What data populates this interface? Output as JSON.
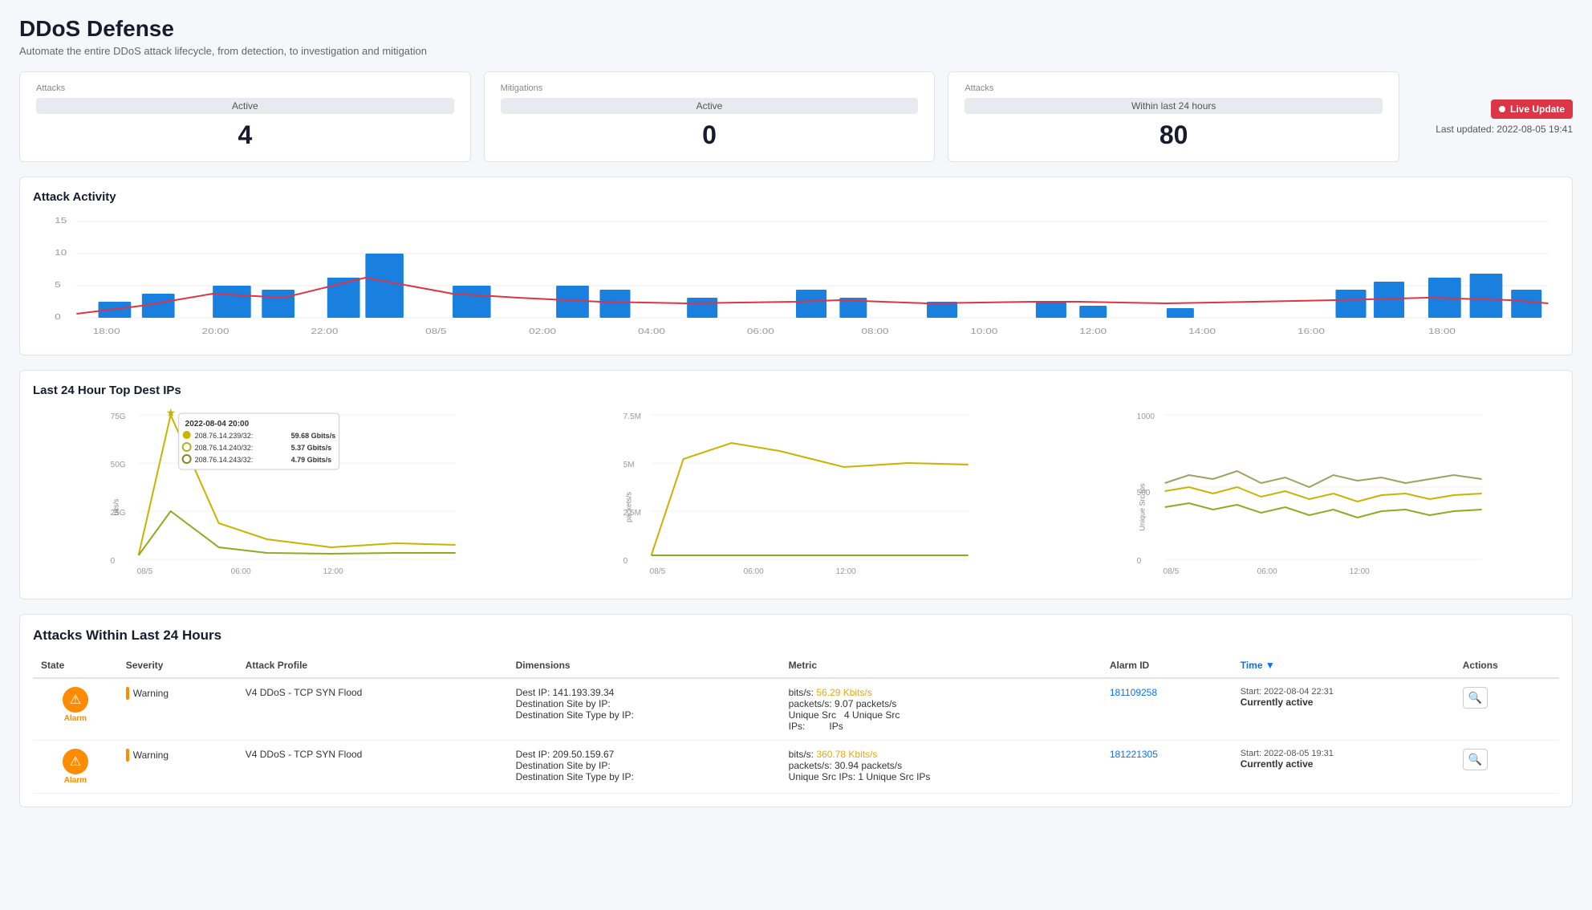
{
  "page": {
    "title": "DDoS Defense",
    "subtitle": "Automate the entire DDoS attack lifecycle, from detection, to investigation and mitigation"
  },
  "summary": {
    "attacks_active_label": "Attacks",
    "attacks_active_sublabel": "Active",
    "attacks_active_value": "4",
    "mitigations_active_label": "Mitigations",
    "mitigations_active_sublabel": "Active",
    "mitigations_active_value": "0",
    "attacks_24h_label": "Attacks",
    "attacks_24h_sublabel": "Within last 24 hours",
    "attacks_24h_value": "80",
    "live_badge": "Live Update",
    "last_updated": "Last updated: 2022-08-05 19:41"
  },
  "attack_activity": {
    "title": "Attack Activity",
    "y_labels": [
      "15",
      "10",
      "5",
      "0"
    ],
    "x_labels": [
      "18:00",
      "20:00",
      "22:00",
      "08/5",
      "02:00",
      "04:00",
      "06:00",
      "08:00",
      "10:00",
      "12:00",
      "14:00",
      "16:00",
      "18:00"
    ]
  },
  "top_dest_ips": {
    "title": "Last 24 Hour Top Dest IPs",
    "tooltip": {
      "time": "2022-08-04 20:00",
      "items": [
        {
          "color": "#c8b400",
          "label": "208.76.14.239/32:",
          "value": "59.68 Gbits/s"
        },
        {
          "color": "#b0b020",
          "label": "208.76.14.240/32:",
          "value": "5.37 Gbits/s"
        },
        {
          "color": "#808820",
          "label": "208.76.14.243/32:",
          "value": "4.79 Gbits/s"
        }
      ]
    },
    "chart1": {
      "y_label": "bits/s",
      "y_ticks": [
        "75G",
        "50G",
        "25G",
        "0"
      ],
      "x_ticks": [
        "08/5",
        "06:00",
        "12:00"
      ]
    },
    "chart2": {
      "y_label": "packets/s",
      "y_ticks": [
        "7.5M",
        "5M",
        "2.5M",
        "0"
      ],
      "x_ticks": [
        "08/5",
        "06:00",
        "12:00"
      ]
    },
    "chart3": {
      "y_label": "Unique Src Ips",
      "y_ticks": [
        "1000",
        "500",
        "0"
      ],
      "x_ticks": [
        "08/5",
        "06:00",
        "12:00"
      ]
    }
  },
  "attacks_table": {
    "title": "Attacks Within Last 24 Hours",
    "columns": [
      "State",
      "Severity",
      "Attack Profile",
      "Dimensions",
      "Metric",
      "Alarm ID",
      "Time",
      "Actions"
    ],
    "sortable_col": "Time",
    "rows": [
      {
        "state": "Alarm",
        "severity": "Warning",
        "attack_profile": "V4 DDoS - TCP SYN Flood",
        "dimensions": "Dest IP: 141.193.39.34\nDestination Site by IP:\nDestination Site Type by IP:",
        "metric_label1": "bits/s:",
        "metric_val1": "56.29 Kbits/s",
        "metric_label2": "packets/s:",
        "metric_val2": "9.07 packets/s",
        "metric_label3": "Unique Src",
        "metric_val3": "4 Unique Src",
        "metric_label4": "IPs:",
        "metric_val4": "IPs",
        "alarm_id": "181109258",
        "start_time": "Start:   2022-08-04 22:31",
        "status": "Currently active"
      },
      {
        "state": "Alarm",
        "severity": "Warning",
        "attack_profile": "V4 DDoS - TCP SYN Flood",
        "dimensions": "Dest IP: 209.50.159.67\nDestination Site by IP:\nDestination Site Type by IP:",
        "metric_label1": "bits/s:",
        "metric_val1": "360.78 Kbits/s",
        "metric_label2": "packets/s:",
        "metric_val2": "30.94 packets/s",
        "metric_label3": "Unique Src IPs:",
        "metric_val3": "1 Unique Src IPs",
        "metric_label4": "",
        "metric_val4": "",
        "alarm_id": "181221305",
        "start_time": "Start:   2022-08-05 19:31",
        "status": "Currently active"
      }
    ]
  },
  "colors": {
    "blue": "#0d6efd",
    "bar_blue": "#1a80e0",
    "red_line": "#dc3545",
    "orange": "#ff8c00",
    "yellow_green": "#b8c020",
    "green_line": "#8aac20",
    "accent_yellow": "#e6a817"
  }
}
